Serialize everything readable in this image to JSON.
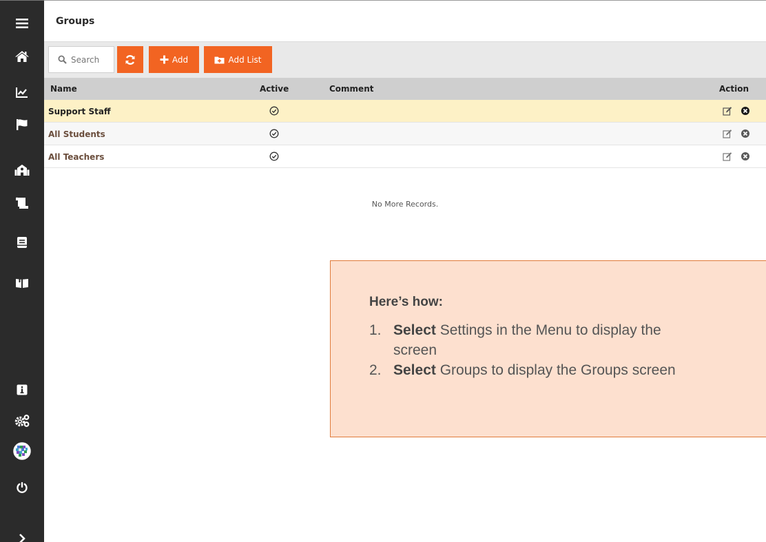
{
  "sidebar": {
    "top_items": [
      {
        "name": "menu-icon"
      },
      {
        "name": "home-icon"
      },
      {
        "name": "chart-icon"
      },
      {
        "name": "flag-icon"
      },
      {
        "name": "school-icon"
      },
      {
        "name": "scroll-icon"
      },
      {
        "name": "book-icon"
      },
      {
        "name": "open-book-icon"
      }
    ],
    "bottom_items": [
      {
        "name": "info-icon"
      },
      {
        "name": "settings-gears-icon"
      },
      {
        "name": "avatar-icon"
      },
      {
        "name": "power-icon"
      },
      {
        "name": "chevron-right-icon"
      }
    ]
  },
  "header": {
    "title": "Groups"
  },
  "toolbar": {
    "search_placeholder": "Search",
    "add_label": "Add",
    "add_list_label": "Add List",
    "accent_color": "#f26422"
  },
  "table": {
    "columns": {
      "name": "Name",
      "active": "Active",
      "comment": "Comment",
      "action": "Action"
    },
    "rows": [
      {
        "name": "Support Staff",
        "active": true,
        "comment": "",
        "selected": true
      },
      {
        "name": "All Students",
        "active": true,
        "comment": "",
        "selected": false
      },
      {
        "name": "All Teachers",
        "active": true,
        "comment": "",
        "selected": false
      }
    ],
    "footer": "No More Records."
  },
  "callout": {
    "title": "Here’s how:",
    "steps": [
      {
        "num": "1.",
        "verb": "Select",
        "text": " Settings in the Menu to display the",
        "text2": "screen"
      },
      {
        "num": "2.",
        "verb": "Select",
        "text": " Groups to display the Groups screen"
      }
    ]
  }
}
